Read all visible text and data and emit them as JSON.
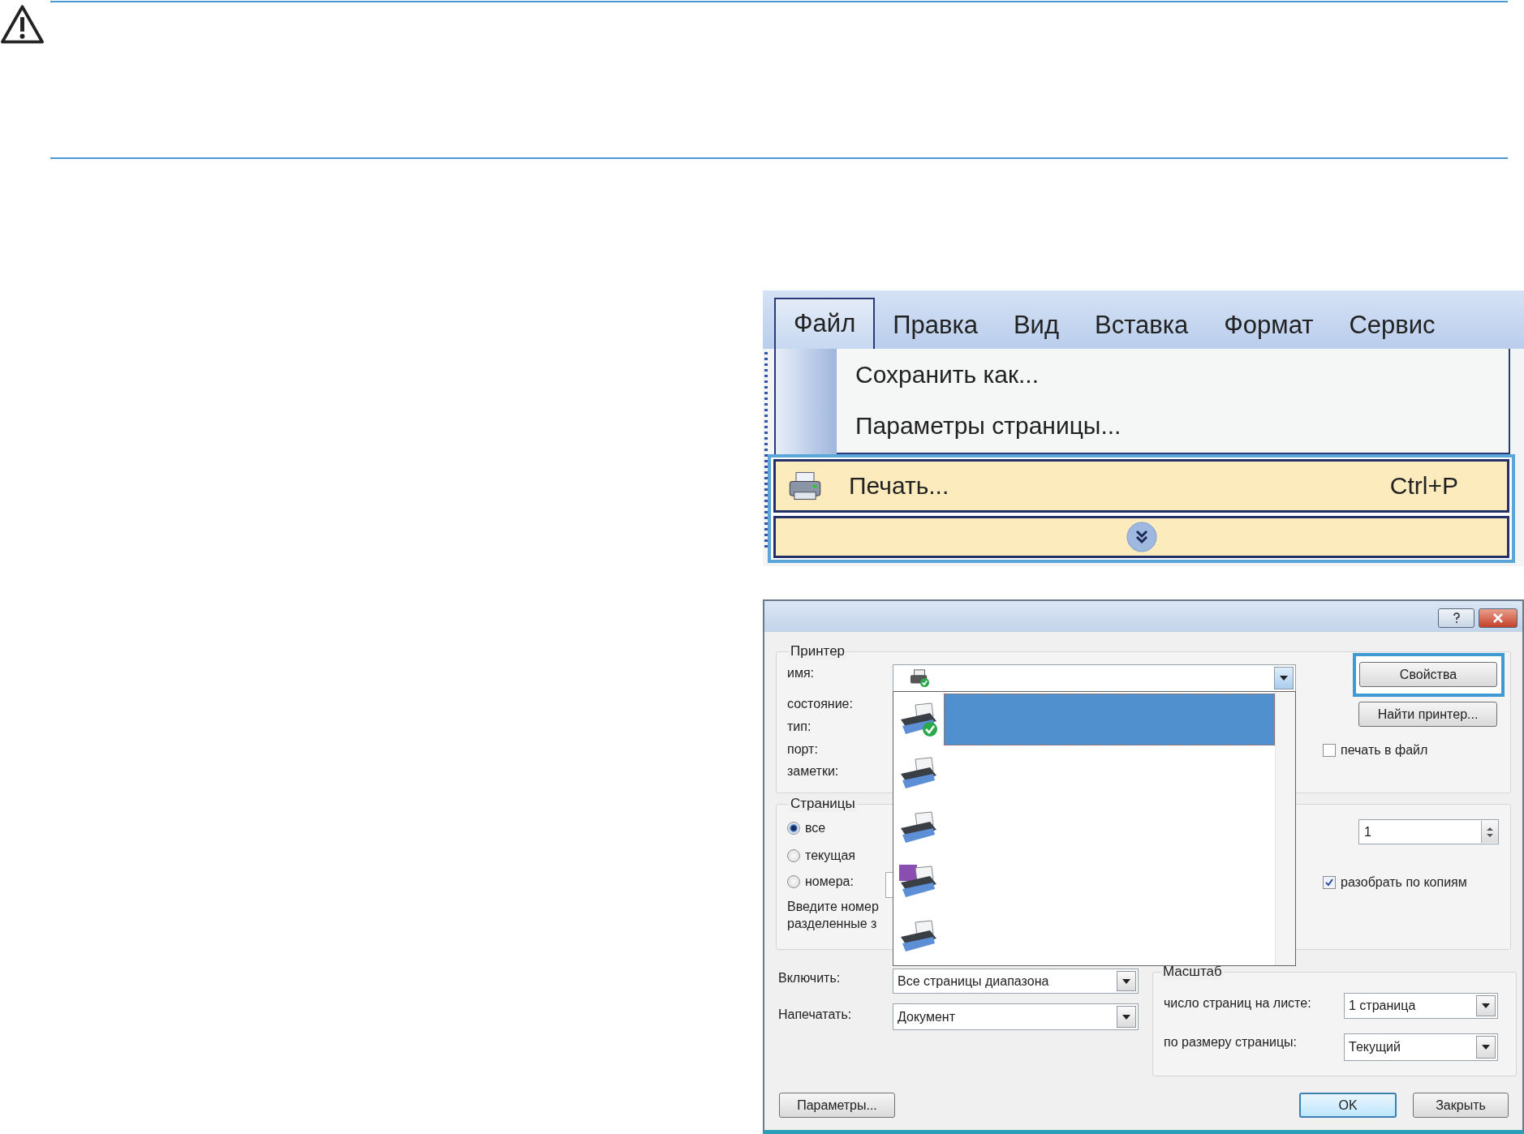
{
  "menu": {
    "bar": [
      {
        "label": "Файл",
        "selected": true
      },
      {
        "label": "Правка",
        "selected": false
      },
      {
        "label": "Вид",
        "selected": false
      },
      {
        "label": "Вставка",
        "selected": false
      },
      {
        "label": "Формат",
        "selected": false
      },
      {
        "label": "Сервис",
        "selected": false
      }
    ],
    "entries": [
      {
        "kind": "command",
        "label": "Сохранить как...",
        "highlighted": false
      },
      {
        "kind": "command",
        "label": "Параметры страницы...",
        "highlighted": false
      },
      {
        "kind": "print",
        "label": "Печать...",
        "shortcut": "Ctrl+P",
        "highlighted": true
      },
      {
        "kind": "expand",
        "highlighted": true
      }
    ]
  },
  "dialog": {
    "printer": {
      "title": "Принтер",
      "fields": [
        "имя:",
        "состояние:",
        "тип:",
        "порт:",
        "заметки:"
      ],
      "properties_button": {
        "label": "Свойства",
        "highlighted": true
      },
      "find_button": "Найти принтер...",
      "print_to_file": {
        "label": "печать в файл",
        "checked": false
      },
      "list": [
        {
          "kind": "default",
          "selected": true
        },
        {
          "kind": "printer",
          "selected": false
        },
        {
          "kind": "printer",
          "selected": false
        },
        {
          "kind": "file",
          "selected": false
        },
        {
          "kind": "printer",
          "selected": false
        }
      ]
    },
    "pages": {
      "title": "Страницы",
      "options": [
        {
          "label": "все",
          "selected": true
        },
        {
          "label": "текущая",
          "selected": false
        },
        {
          "label": "номера:",
          "selected": false
        }
      ],
      "hint": [
        "Введите номер",
        "разделенные з"
      ],
      "copies": "1",
      "collate": {
        "label": "разобрать по копиям",
        "checked": true
      }
    },
    "include": {
      "label": "Включить:",
      "value": "Все страницы диапазона"
    },
    "print_what": {
      "label": "Напечатать:",
      "value": "Документ"
    },
    "scale": {
      "title": "Масштаб",
      "pages_per_sheet": {
        "label": "число страниц на листе:",
        "value": "1 страница"
      },
      "fit": {
        "label": "по размеру страницы:",
        "value": "Текущий"
      }
    },
    "buttons": {
      "options": "Параметры...",
      "ok": "OK",
      "close": "Закрыть"
    }
  }
}
